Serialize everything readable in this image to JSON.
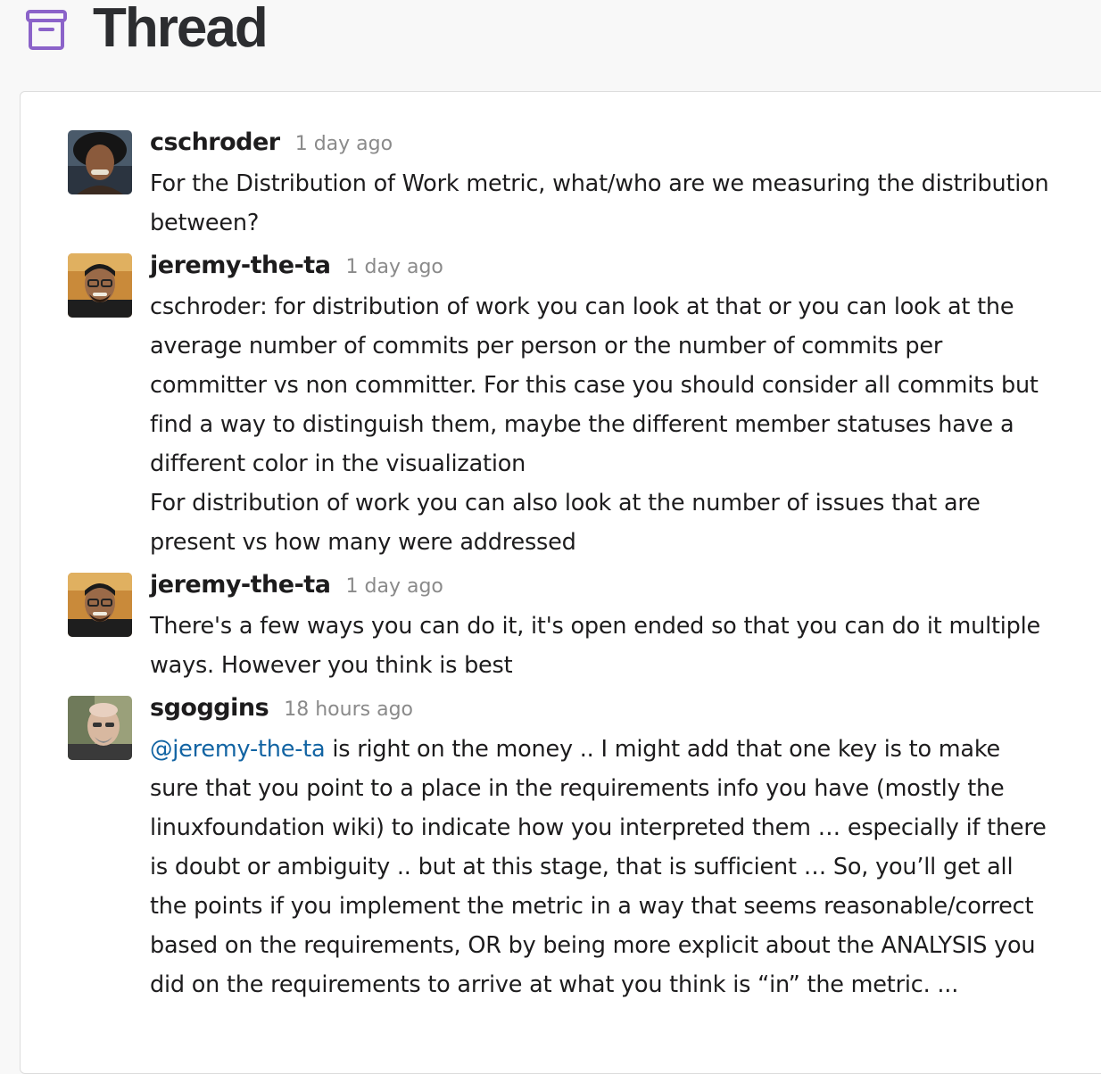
{
  "header": {
    "title": "Thread",
    "icon": "archive-icon",
    "icon_color": "#8b63c9"
  },
  "messages": [
    {
      "author": "cschroder",
      "time": "1 day ago",
      "paragraphs": [
        "For the Distribution of Work metric, what/who are we measuring the distribution between?"
      ]
    },
    {
      "author": "jeremy-the-ta",
      "time": "1 day ago",
      "paragraphs": [
        "cschroder: for distribution of work you can look at that or you can look at the average number of commits per person or the number of commits per committer vs non committer.  For this case you should consider all commits but find a way to distinguish them, maybe the different member statuses have a different color in the visualization",
        "For distribution of work you can also look at the number of issues that are present vs how many were addressed"
      ]
    },
    {
      "author": "jeremy-the-ta",
      "time": "1 day ago",
      "paragraphs": [
        "There's a few ways you can do it, it's open ended so that you can do it multiple ways. However you think is best"
      ]
    },
    {
      "author": "sgoggins",
      "time": "18 hours ago",
      "mention": "@jeremy-the-ta",
      "paragraphs": [
        " is right on the money .. I might add that one key is to make sure that you point to a place in the requirements info you have (mostly the linuxfoundation wiki) to indicate how you interpreted them … especially if there is doubt or ambiguity .. but at this stage, that is sufficient … So, you’ll get all the points if you implement the metric in a way that seems reasonable/correct based on the requirements, OR by being more explicit about the ANALYSIS you did on the requirements to arrive at what you think is “in” the metric. ..."
      ]
    }
  ],
  "colors": {
    "mention": "#1264a3",
    "timestamp": "#8a8a8a",
    "text": "#1d1c1d"
  }
}
